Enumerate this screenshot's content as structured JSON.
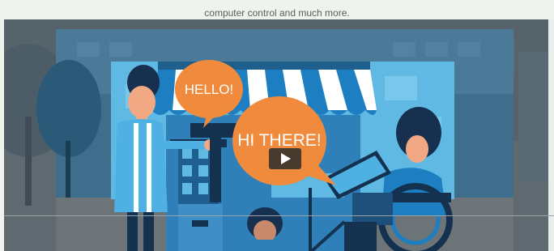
{
  "header": {
    "caption": "computer control and much more."
  },
  "video": {
    "bubble_left": "HELLO!",
    "bubble_right": "HI THERE!",
    "play_button": "play"
  },
  "colors": {
    "overlay": "#566268",
    "sky": "#5fb9e3",
    "orange": "#f08a3c",
    "navy": "#17304f",
    "page_bg": "#eef3ee"
  }
}
